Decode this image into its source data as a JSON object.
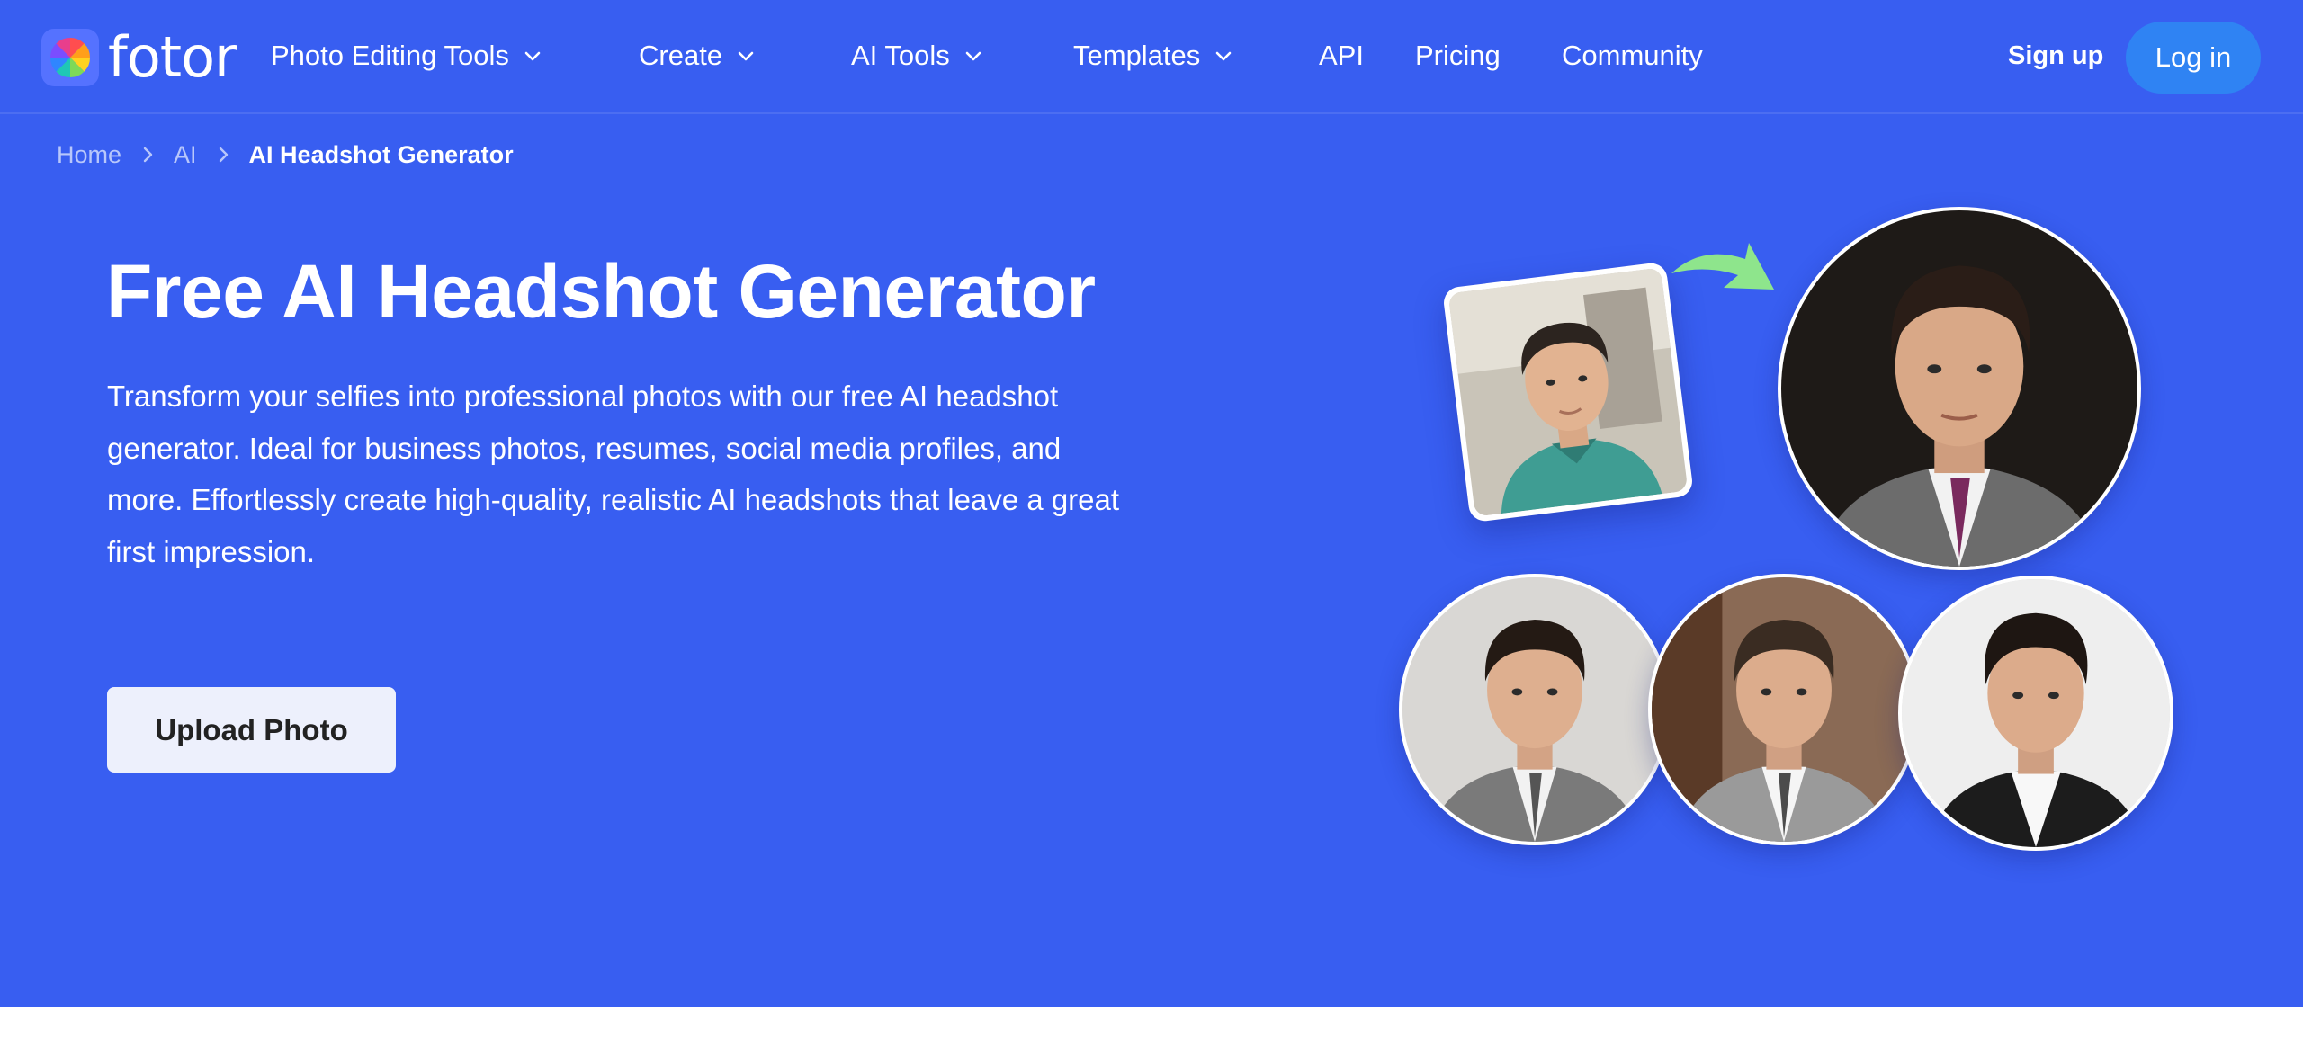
{
  "brand": {
    "name": "fotor"
  },
  "nav": {
    "items": [
      {
        "label": "Photo Editing Tools",
        "has_dropdown": true
      },
      {
        "label": "Create",
        "has_dropdown": true
      },
      {
        "label": "AI Tools",
        "has_dropdown": true
      },
      {
        "label": "Templates",
        "has_dropdown": true
      },
      {
        "label": "API",
        "has_dropdown": false
      },
      {
        "label": "Pricing",
        "has_dropdown": false
      },
      {
        "label": "Community",
        "has_dropdown": false
      }
    ],
    "signup_label": "Sign up",
    "login_label": "Log in"
  },
  "breadcrumb": {
    "items": [
      "Home",
      "AI"
    ],
    "current": "AI Headshot Generator"
  },
  "hero": {
    "title": "Free AI Headshot Generator",
    "description": "Transform your selfies into professional photos with our free AI headshot generator. Ideal for business photos, resumes, social media profiles, and more. Effortlessly create high-quality, realistic AI headshots that leave a great first impression.",
    "upload_label": "Upload Photo"
  },
  "colors": {
    "hero_background": "#385ef1",
    "login_button": "#2f83f3",
    "upload_button": "#edf0fc",
    "arrow": "#8ee58c"
  },
  "icons": {
    "dropdown": "chevron-down-icon",
    "breadcrumb_separator": "chevron-right-icon",
    "transform_arrow": "curved-arrow-icon"
  }
}
